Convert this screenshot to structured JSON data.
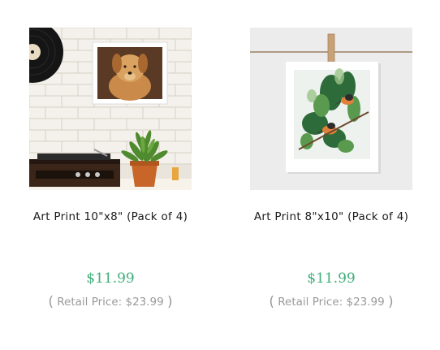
{
  "products": [
    {
      "title": "Art Print 10\"x8\" (Pack of 4)",
      "price": "$11.99",
      "retail_label": "Retail Price: $23.99",
      "paren_open": "(",
      "paren_close": ")"
    },
    {
      "title": "Art Print 8\"x10\" (Pack of 4)",
      "price": "$11.99",
      "retail_label": "Retail Price: $23.99",
      "paren_open": "(",
      "paren_close": ")"
    }
  ],
  "colors": {
    "price": "#3fae7a",
    "retail": "#9a9a9a",
    "title": "#1a1a1a"
  }
}
